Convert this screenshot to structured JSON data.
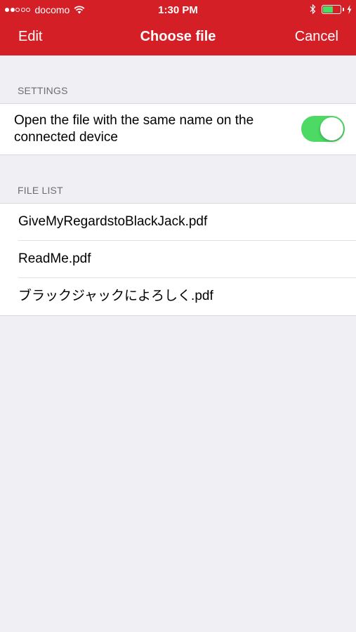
{
  "status_bar": {
    "carrier": "docomo",
    "signal_filled": 2,
    "signal_total": 5,
    "time": "1:30 PM",
    "battery_level": 0.6,
    "battery_color": "#4cd964"
  },
  "nav": {
    "edit_label": "Edit",
    "title": "Choose file",
    "cancel_label": "Cancel",
    "bar_color": "#d51f26"
  },
  "settings": {
    "header": "SETTINGS",
    "open_same_name_label": "Open the file with the same name on the connected device",
    "open_same_name_enabled": true
  },
  "file_list": {
    "header": "FILE LIST",
    "files": [
      {
        "name": "GiveMyRegardstoBlackJack.pdf"
      },
      {
        "name": "ReadMe.pdf"
      },
      {
        "name": "ブラックジャックによろしく.pdf"
      }
    ]
  }
}
